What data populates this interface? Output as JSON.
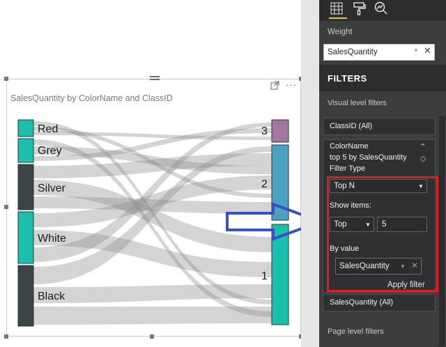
{
  "visual": {
    "title": "SalesQuantity by ColorName and ClassID"
  },
  "chart_data": {
    "type": "sankey",
    "title": "SalesQuantity by ColorName and ClassID",
    "source_nodes": [
      "Red",
      "Grey",
      "Silver",
      "White",
      "Black"
    ],
    "target_nodes": [
      "3",
      "2",
      "1"
    ],
    "colors": {
      "source": [
        "#1abfae",
        "#1abfae",
        "#3d4446",
        "#1abfae",
        "#3d4446"
      ],
      "target": [
        "#a676a2",
        "#4aa1c1",
        "#1abfae"
      ],
      "link": "#8f8f8f"
    }
  },
  "pane": {
    "weight_label": "Weight",
    "weight_field": "SalesQuantity",
    "filters_header": "FILTERS",
    "visual_level_label": "Visual level filters",
    "classid_filter": "ClassID (All)",
    "colorname": {
      "field": "ColorName",
      "summary": "top 5 by SalesQuantity",
      "filter_type_label": "Filter Type",
      "filter_type_value": "Top N",
      "show_items_label": "Show items:",
      "show_items_direction": "Top",
      "show_items_count": "5",
      "by_value_label": "By value",
      "by_value_field": "SalesQuantity",
      "apply_label": "Apply filter"
    },
    "salesquantity_filter": "SalesQuantity (All)",
    "page_level_label": "Page level filters"
  },
  "accent": {
    "highlight": "#e41c1c",
    "arrow": "#3b4fc4",
    "tab": "#f2c811"
  }
}
